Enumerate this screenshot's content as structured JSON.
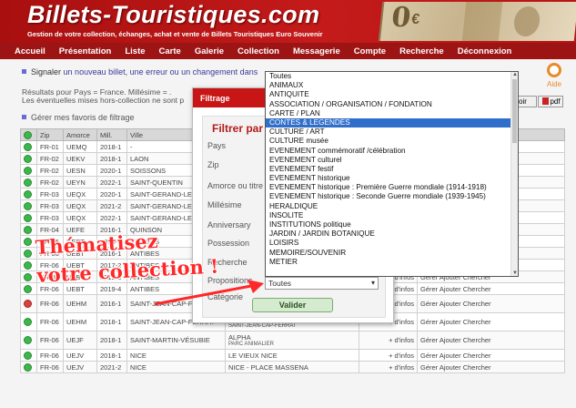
{
  "header": {
    "title": "Billets-Touristiques.com",
    "subtitle": "Gestion de votre collection, échanges, achat et vente de Billets Touristiques Euro Souvenir"
  },
  "nav": [
    "Accueil",
    "Présentation",
    "Liste",
    "Carte",
    "Galerie",
    "Collection",
    "Messagerie",
    "Compte",
    "Recherche",
    "Déconnexion"
  ],
  "help": {
    "label": "Aide"
  },
  "info": {
    "signal_prefix": "Signaler",
    "signal_link": "un nouveau billet, une erreur ou un changement dans",
    "results": "Résultats pour Pays = France. Millésime = .",
    "missing": "Les éventuelles mises hors-collection ne sont p",
    "favorites": "Gérer mes favoris de filtrage"
  },
  "buttons": {
    "voir": "voir",
    "pdf": "pdf",
    "validate": "Valider"
  },
  "table": {
    "headers": [
      "",
      "Zip",
      "Amorce",
      "Mill.",
      "Ville",
      "",
      "",
      ""
    ],
    "rows": [
      {
        "status": "green",
        "zip": "FR-01",
        "amorce": "UEMQ",
        "mill": "2018-1",
        "ville": "-",
        "lieu": "",
        "lieu_sub": "",
        "infos": "",
        "actions": ""
      },
      {
        "status": "green",
        "zip": "FR-02",
        "amorce": "UEKV",
        "mill": "2018-1",
        "ville": "LAON",
        "lieu": "",
        "lieu_sub": "",
        "infos": "",
        "actions": ""
      },
      {
        "status": "green",
        "zip": "FR-02",
        "amorce": "UESN",
        "mill": "2020-1",
        "ville": "SOISSONS",
        "lieu": "",
        "lieu_sub": "",
        "infos": "",
        "actions": ""
      },
      {
        "status": "green",
        "zip": "FR-02",
        "amorce": "UEYN",
        "mill": "2022-1",
        "ville": "SAINT-QUENTIN",
        "lieu": "",
        "lieu_sub": "",
        "infos": "",
        "actions": ""
      },
      {
        "status": "green",
        "zip": "FR-03",
        "amorce": "UEQX",
        "mill": "2020-1",
        "ville": "SAINT-GERAND-LE",
        "lieu": "",
        "lieu_sub": "",
        "infos": "",
        "actions": ""
      },
      {
        "status": "green",
        "zip": "FR-03",
        "amorce": "UEQX",
        "mill": "2021-2",
        "ville": "SAINT-GERAND-LE",
        "lieu": "",
        "lieu_sub": "",
        "infos": "",
        "actions": ""
      },
      {
        "status": "green",
        "zip": "FR-03",
        "amorce": "UEQX",
        "mill": "2022-1",
        "ville": "SAINT-GERAND-LE",
        "lieu": "",
        "lieu_sub": "",
        "infos": "",
        "actions": ""
      },
      {
        "status": "green",
        "zip": "FR-04",
        "amorce": "UEFE",
        "mill": "2016-1",
        "ville": "QUINSON",
        "lieu": "",
        "lieu_sub": "",
        "infos": "",
        "actions": ""
      },
      {
        "status": "green",
        "zip": "FR-06",
        "amorce": "UEBT",
        "mill": "2015-1",
        "ville": "ANTIBES",
        "lieu": "",
        "lieu_sub": "",
        "infos": "",
        "actions": ""
      },
      {
        "status": "green",
        "zip": "FR-06",
        "amorce": "UEBT",
        "mill": "2016-1",
        "ville": "ANTIBES",
        "lieu": "",
        "lieu_sub": "",
        "infos": "+ d'infos",
        "actions": "Gérer Ajouter Chercher"
      },
      {
        "status": "green",
        "zip": "FR-06",
        "amorce": "UEBT",
        "mill": "2017-2",
        "ville": "ANTIBES",
        "lieu": "",
        "lieu_sub": "",
        "infos": "+ d'infos",
        "actions": "Gérer Ajouter Chercher"
      },
      {
        "status": "green",
        "zip": "FR-06",
        "amorce": "UEBT",
        "mill": "2019-3",
        "ville": "ANTIBES",
        "lieu": "",
        "lieu_sub": "",
        "infos": "+ d'infos",
        "actions": "Gérer Ajouter Chercher"
      },
      {
        "status": "green",
        "zip": "FR-06",
        "amorce": "UEBT",
        "mill": "2019-4",
        "ville": "ANTIBES",
        "lieu": "",
        "lieu_sub": "",
        "infos": "+ d'infos",
        "actions": "Gérer Ajouter Chercher"
      },
      {
        "status": "red",
        "zip": "FR-06",
        "amorce": "UEHM",
        "mill": "2016-1",
        "ville": "SAINT-JEAN-CAP-FERRAT",
        "lieu": "VILLA EPHRUSSI DE ROTHSCHILD",
        "lieu_sub": "SAINT-JEAN-CAP-FERRAT",
        "infos": "+ d'infos",
        "actions": "Gérer Ajouter Chercher"
      },
      {
        "status": "green",
        "zip": "FR-06",
        "amorce": "UEHM",
        "mill": "2018-1",
        "ville": "SAINT-JEAN-CAP-FERRAT",
        "lieu": "VILLA EPHRUSSI DE ROTHSCHILD",
        "lieu_sub": "SAINT-JEAN-CAP-FERRAT",
        "infos": "+ d'infos",
        "actions": "Gérer Ajouter Chercher"
      },
      {
        "status": "green",
        "zip": "FR-06",
        "amorce": "UEJF",
        "mill": "2018-1",
        "ville": "SAINT-MARTIN-VÉSUBIE",
        "lieu": "ALPHA",
        "lieu_sub": "PARC ANIMALIER",
        "infos": "+ d'infos",
        "actions": "Gérer Ajouter Chercher"
      },
      {
        "status": "green",
        "zip": "FR-06",
        "amorce": "UEJV",
        "mill": "2018-1",
        "ville": "NICE",
        "lieu": "LE VIEUX NICE",
        "lieu_sub": "",
        "infos": "+ d'infos",
        "actions": "Gérer Ajouter Chercher"
      },
      {
        "status": "green",
        "zip": "FR-06",
        "amorce": "UEJV",
        "mill": "2021-2",
        "ville": "NICE",
        "lieu": "NICE - PLACE MASSENA",
        "lieu_sub": "",
        "infos": "+ d'infos",
        "actions": "Gérer Ajouter Chercher"
      }
    ]
  },
  "filter": {
    "title": "Filtrage",
    "heading": "Filtrer par",
    "labels": [
      "Pays",
      "Zip",
      "Amorce ou titre",
      "Millésime",
      "Anniversary",
      "Possession",
      "Recherche",
      "Propositions",
      "Catégorie"
    ],
    "category_selected": "Toutes"
  },
  "dropdown": {
    "selected_index": 7,
    "options": [
      "Toutes",
      "ANIMAUX",
      "ANTIQUITE",
      "ASSOCIATION / ORGANISATION / FONDATION",
      "CARTE / PLAN",
      "CONTES & LEGENDES",
      "CULTURE / ART",
      "CULTURE musée",
      "EVENEMENT commémoratif /célébration",
      "EVENEMENT culturel",
      "EVENEMENT festif",
      "EVENEMENT historique",
      "EVENEMENT historique : Première Guerre mondiale (1914-1918)",
      "EVENEMENT historique : Seconde Guerre mondiale (1939-1945)",
      "HERALDIQUE",
      "INSOLITE",
      "INSTITUTIONS politique",
      "JARDIN / JARDIN BOTANIQUE",
      "LOISIRS",
      "MEMOIRE/SOUVENIR",
      "METIER"
    ]
  },
  "promo": {
    "line1": "Thématisez",
    "line2": "votre collection !"
  },
  "colors": {
    "header_red": "#c41a1a",
    "nav_red": "#9c1414",
    "select_blue": "#2f6ec9",
    "promo_red": "#ff2828",
    "status_green": "#3cb84a"
  }
}
